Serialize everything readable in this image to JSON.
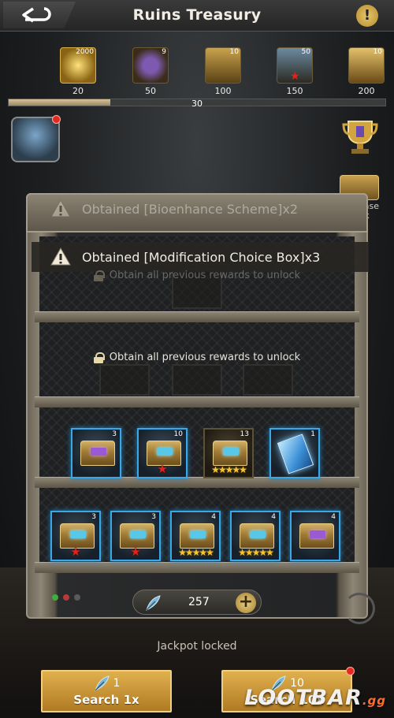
{
  "header": {
    "title": "Ruins Treasury",
    "info_glyph": "!"
  },
  "milestones": [
    {
      "icon": "gold-key-bundle-icon",
      "count": "2000",
      "value": "20"
    },
    {
      "icon": "purple-medal-icon",
      "count": "9",
      "value": "50"
    },
    {
      "icon": "mystery-chest-icon",
      "count": "10",
      "value": "100"
    },
    {
      "icon": "red-star-chest-icon",
      "count": "50",
      "value": "150"
    },
    {
      "icon": "gold-choice-chest-icon",
      "count": "10",
      "value": "200"
    }
  ],
  "progress": {
    "label": "30",
    "fraction": 0.27
  },
  "side": {
    "purchase_pack_label": "Purchase Pack"
  },
  "notifications": {
    "faded": "Obtained [Bioenhance Scheme]x2",
    "main": "Obtained [Modification Choice Box]x3"
  },
  "lock_text_faded": "Obtain all previous rewards to unlock",
  "lock_text": "Obtain all previous rewards to unlock",
  "shelf3": [
    {
      "icon": "purple-gem-chest-icon",
      "count": "3",
      "style": "purple",
      "mark": ""
    },
    {
      "icon": "red-star-chest-icon",
      "count": "10",
      "style": "",
      "mark": "red"
    },
    {
      "icon": "five-star-chest-icon",
      "count": "13",
      "style": "",
      "mark": "stars"
    },
    {
      "icon": "blue-card-icon",
      "count": "1",
      "style": "card",
      "mark": ""
    }
  ],
  "shelf4": [
    {
      "icon": "red-star-chest-icon",
      "count": "3",
      "mark": "red"
    },
    {
      "icon": "red-star-chest-icon",
      "count": "3",
      "mark": "red"
    },
    {
      "icon": "five-star-chest-icon",
      "count": "4",
      "mark": "stars"
    },
    {
      "icon": "five-star-chest-icon",
      "count": "4",
      "mark": "stars"
    },
    {
      "icon": "purple-gem-chest-icon",
      "count": "4",
      "mark": ""
    }
  ],
  "stars_glyph": "★★★★★",
  "redstar_glyph": "★",
  "currency": {
    "value": "257",
    "plus": "+"
  },
  "page_dots": [
    "#3fae3f",
    "#b43b3b",
    "#5a5a5a"
  ],
  "jackpot_text": "Jackpot locked",
  "buttons": {
    "search1": {
      "cost": "1",
      "label": "Search 1x"
    },
    "search10": {
      "cost": "10",
      "label": "Search 10x"
    }
  },
  "watermark": {
    "main": "LOOTBAR",
    "suffix": ".gg"
  }
}
